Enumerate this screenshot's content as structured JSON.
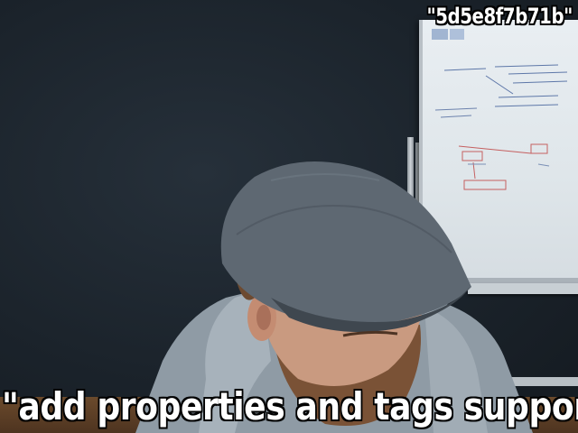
{
  "scene": {
    "description_free": true,
    "colors": {
      "wall": "#1b232b",
      "whiteboard": "#e3e9ed",
      "cap": "#5c6670",
      "hoodie": "#9aa6b0",
      "skin": "#c99a80",
      "beard": "#7a5236"
    }
  },
  "captions": {
    "top": "\"5d5e8f7b71b\"",
    "bottom": "\"add properties and tags support"
  }
}
